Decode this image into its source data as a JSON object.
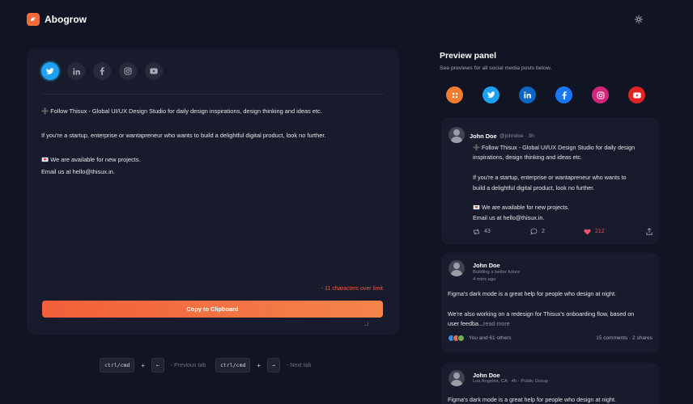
{
  "app": {
    "name": "Abogrow"
  },
  "composer": {
    "tabs": [
      {
        "name": "twitter",
        "icon": "twitter-icon",
        "active": true
      },
      {
        "name": "linkedin",
        "icon": "linkedin-icon",
        "active": false
      },
      {
        "name": "facebook",
        "icon": "facebook-icon",
        "active": false
      },
      {
        "name": "instagram",
        "icon": "instagram-icon",
        "active": false
      },
      {
        "name": "youtube",
        "icon": "youtube-icon",
        "active": false
      }
    ],
    "lines": [
      "➕ Follow Thisux - Global UI/UX Design Studio for daily design inspirations, design thinking and ideas etc.",
      "",
      "If you're a startup, enterprise or wantapreneur who wants to build a delightful digital product, look no further.",
      "",
      "💌 We are available for new projects.",
      "Email us at hello@thisux.in."
    ],
    "limit_warning": "- 11 characters over limit",
    "copy_label": "Copy to Clipboard"
  },
  "shortcuts": {
    "mod": "ctrl/cmd",
    "plus": "+",
    "prev_key": "←",
    "prev_label": "- Previous tab",
    "next_key": "→",
    "next_label": "- Next tab"
  },
  "preview": {
    "title": "Preview panel",
    "subtitle": "See previews for all social media posts below.",
    "icons": [
      {
        "name": "all",
        "icon": "grid-icon",
        "color": "#f47b30"
      },
      {
        "name": "twitter",
        "icon": "twitter-icon",
        "color": "#1da1f2"
      },
      {
        "name": "linkedin",
        "icon": "linkedin-icon",
        "color": "#0a66c2"
      },
      {
        "name": "facebook",
        "icon": "facebook-icon",
        "color": "#1877f2"
      },
      {
        "name": "instagram",
        "icon": "instagram-icon",
        "color": "#d6247c"
      },
      {
        "name": "youtube",
        "icon": "youtube-icon",
        "color": "#e02424"
      }
    ],
    "twitter_post": {
      "name": "John Doe",
      "handle": "@johndoe",
      "dot": "·",
      "time": "3h",
      "lines": [
        "➕ Follow Thisux - Global UI/UX Design Studio for daily design",
        "inspirations, design thinking and ideas etc.",
        "",
        "If you're a startup, enterprise or wantapreneur who wants to",
        "build a delightful digital product, look no further.",
        "",
        "💌 We are available for new projects.",
        "Email us at hello@thisux.in."
      ],
      "retweets": "43",
      "replies": "2",
      "likes": "212"
    },
    "linkedin_post": {
      "name": "John Doe",
      "tagline": "Building a better future",
      "time": "4 mins ago",
      "line1": "Figma's dark mode is a great help for people who design at night.",
      "line2": "We're also working on a redesign for Thisux's onboarding flow, based on",
      "line3": "user feedba...",
      "read_more": "read more",
      "reactions": "You and 61 others",
      "stats": "15 comments · 2 shares"
    },
    "facebook_post": {
      "name": "John Doe",
      "location": "Los Angeles, CA",
      "time": "4h",
      "audience": "Public Group",
      "line1": "Figma's dark mode is a great help for people who design at night."
    }
  }
}
